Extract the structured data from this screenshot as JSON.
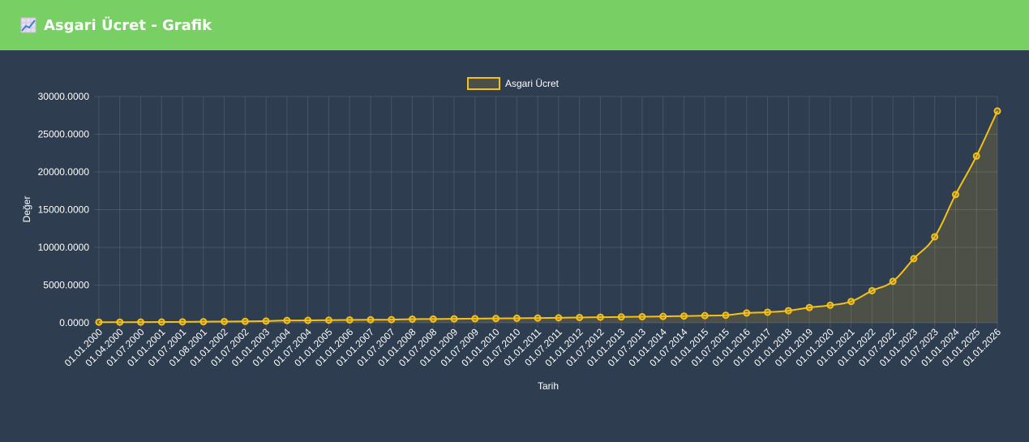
{
  "header": {
    "title": "Asgari Ücret - Grafik",
    "icon": "chart-increasing-icon"
  },
  "colors": {
    "header": "#78d064",
    "background": "#2e3d4f",
    "line": "#f5c116",
    "fill": "rgba(245,193,22,0.15)"
  },
  "chart_data": {
    "type": "line",
    "title": "",
    "xlabel": "Tarih",
    "ylabel": "Değer",
    "ylim": [
      0,
      30000
    ],
    "yticks": [
      "0.0000",
      "5000.0000",
      "10000.0000",
      "15000.0000",
      "20000.0000",
      "25000.0000",
      "30000.0000"
    ],
    "yticks_values": [
      0,
      5000,
      10000,
      15000,
      20000,
      25000,
      30000
    ],
    "grid": true,
    "legend": "top",
    "fill": true,
    "categories": [
      "01.01.2000",
      "01.04.2000",
      "01.07.2000",
      "01.01.2001",
      "01.07.2001",
      "01.08.2001",
      "01.01.2002",
      "01.07.2002",
      "01.01.2003",
      "01.01.2004",
      "01.07.2004",
      "01.01.2005",
      "01.01.2006",
      "01.01.2007",
      "01.07.2007",
      "01.01.2008",
      "01.07.2008",
      "01.01.2009",
      "01.07.2009",
      "01.01.2010",
      "01.07.2010",
      "01.01.2011",
      "01.07.2011",
      "01.01.2012",
      "01.07.2012",
      "01.01.2013",
      "01.07.2013",
      "01.01.2014",
      "01.07.2014",
      "01.01.2015",
      "01.07.2015",
      "01.01.2016",
      "01.01.2017",
      "01.01.2018",
      "01.01.2019",
      "01.01.2020",
      "01.01.2021",
      "01.01.2022",
      "01.07.2022",
      "01.01.2023",
      "01.07.2023",
      "01.01.2024",
      "01.01.2025",
      "01.01.2026"
    ],
    "series": [
      {
        "name": "Asgari Ücret",
        "values": [
          85,
          84,
          92,
          101,
          122,
          147,
          164,
          184,
          226,
          303,
          318,
          350,
          380,
          403,
          419,
          482,
          503,
          527,
          546,
          577,
          599,
          630,
          659,
          701,
          740,
          773,
          804,
          846,
          891,
          949,
          1001,
          1301,
          1404,
          1603,
          2021,
          2325,
          2826,
          4253,
          5500,
          8507,
          11402,
          17002,
          22105,
          28076
        ]
      }
    ]
  }
}
